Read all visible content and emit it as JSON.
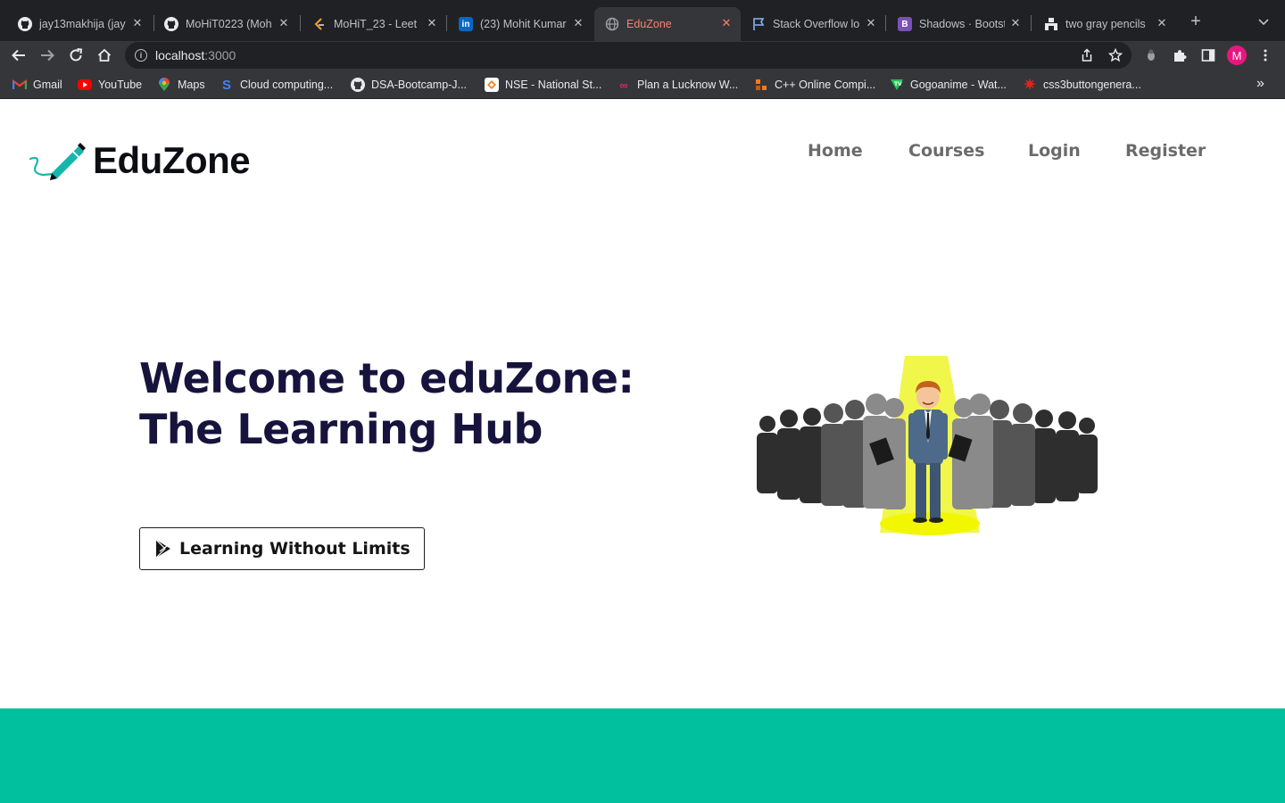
{
  "browser": {
    "tabs": [
      {
        "title": "jay13makhija (jay",
        "favicon": "github-icon",
        "active": false
      },
      {
        "title": "MoHiT0223 (Moh",
        "favicon": "github-icon",
        "active": false
      },
      {
        "title": "MoHiT_23 - Leet",
        "favicon": "leetcode-icon",
        "active": false
      },
      {
        "title": "(23) Mohit Kumar",
        "favicon": "linkedin-icon",
        "active": false
      },
      {
        "title": "EduZone",
        "favicon": "globe-icon",
        "active": true
      },
      {
        "title": "Stack Overflow lo",
        "favicon": "flag-icon",
        "active": false
      },
      {
        "title": "Shadows · Bootst",
        "favicon": "bootstrap-icon",
        "active": false
      },
      {
        "title": "two gray pencils",
        "favicon": "unsplash-icon",
        "active": false
      }
    ],
    "url_host": "localhost",
    "url_port": ":3000",
    "profile_initial": "M",
    "bookmarks": [
      {
        "label": "Gmail",
        "icon": "gmail-icon"
      },
      {
        "label": "YouTube",
        "icon": "youtube-icon"
      },
      {
        "label": "Maps",
        "icon": "maps-icon"
      },
      {
        "label": "Cloud computing...",
        "icon": "cloud-icon"
      },
      {
        "label": "DSA-Bootcamp-J...",
        "icon": "github-icon"
      },
      {
        "label": "NSE - National St...",
        "icon": "nse-icon"
      },
      {
        "label": "Plan a Lucknow W...",
        "icon": "travel-icon"
      },
      {
        "label": "C++ Online Compi...",
        "icon": "compiler-icon"
      },
      {
        "label": "Gogoanime - Wat...",
        "icon": "gogoanime-icon"
      },
      {
        "label": "css3buttongenera...",
        "icon": "css3-icon"
      }
    ],
    "bookmarks_overflow": "»"
  },
  "site": {
    "brand": "EduZone",
    "nav": [
      "Home",
      "Courses",
      "Login",
      "Register"
    ],
    "hero_title": "Welcome to eduZone: The Learning Hub",
    "hero_button": "Learning Without Limits",
    "accent_color": "#00c09d",
    "title_color": "#16133d"
  }
}
